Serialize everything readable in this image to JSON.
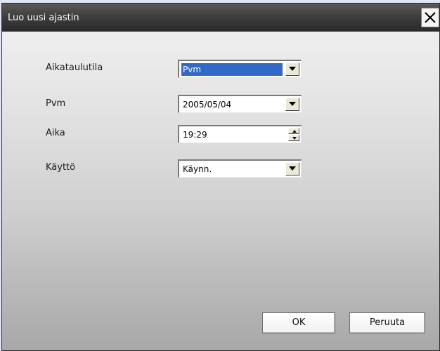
{
  "window": {
    "title": "Luo uusi ajastin",
    "close_icon": "close-icon"
  },
  "form": {
    "schedule_mode": {
      "label": "Aikataulutila",
      "value": "Pvm"
    },
    "date": {
      "label": "Pvm",
      "value": "2005/05/04"
    },
    "time": {
      "label": "Aika",
      "value": "19:29"
    },
    "operation": {
      "label": "Käyttö",
      "value": "Käynn."
    }
  },
  "buttons": {
    "ok_label": "OK",
    "cancel_label": "Peruuta"
  },
  "colors": {
    "selection": "#3169c6",
    "titlebar": "#3e3e3e",
    "page_background": "#dfe7f5"
  }
}
